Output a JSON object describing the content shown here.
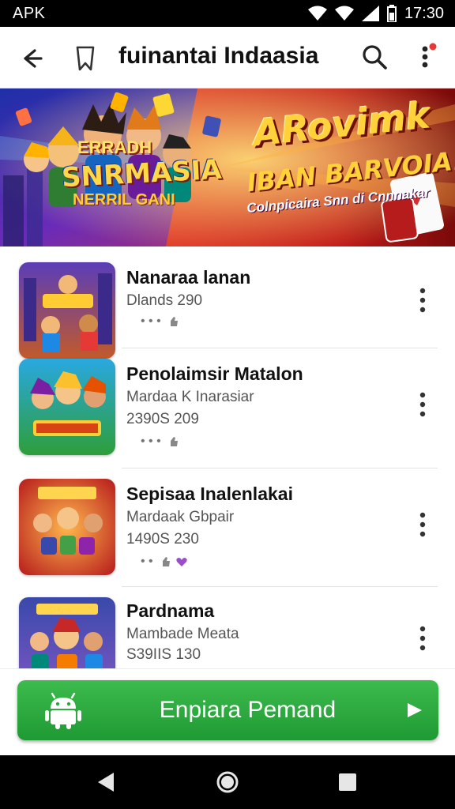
{
  "status": {
    "carrier": "APK",
    "time": "17:30"
  },
  "appbar": {
    "title": "fuinantai Indaasia"
  },
  "banner": {
    "left_pre": "ERRADH",
    "left_title": "SNRMASIA",
    "left_sub": "NERRIL GANI",
    "right_title": "ARovimk",
    "right_sub": "IBAN BARVOIA!",
    "right_tag": "Colnpicaira Snn di Cnnnakar"
  },
  "items": [
    {
      "name": "Nanaraa lanan",
      "sub1": "Dlands 290",
      "sub2": "",
      "meta": "• • •"
    },
    {
      "name": "Penolaimsir Matalon",
      "sub1": "Mardaa K Inarasiar",
      "sub2": "2390S 209",
      "meta": "• • •"
    },
    {
      "name": "Sepisaa Inalenlakai",
      "sub1": "Mardaak Gbpair",
      "sub2": "1490S 230",
      "meta": "• •"
    },
    {
      "name": "Pardnama",
      "sub1": "Mambade Meata",
      "sub2": "S39IIS 130",
      "meta": ""
    }
  ],
  "cta": {
    "label": "Enpiara Pemand"
  },
  "colors": {
    "cta_green": "#2aa83e",
    "banner_red": "#c8201c",
    "banner_yellow": "#ffd23a",
    "accent_badge": "#e53935"
  },
  "icons": {
    "back": "arrow-left-icon",
    "bookmark": "bookmark-icon",
    "search": "search-icon",
    "more": "more-vert-icon",
    "android": "android-icon",
    "play": "play-icon",
    "nav_back": "nav-back-icon",
    "nav_home": "nav-home-icon",
    "nav_recent": "nav-recent-icon"
  }
}
